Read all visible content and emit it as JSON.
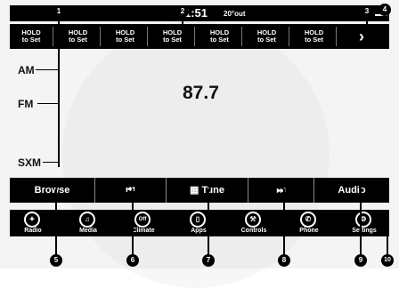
{
  "status": {
    "time": "1:51",
    "temperature": "20°out"
  },
  "presets": [
    "HOLD\nto Set",
    "HOLD\nto Set",
    "HOLD\nto Set",
    "HOLD\nto Set",
    "HOLD\nto Set",
    "HOLD\nto Set",
    "HOLD\nto Set"
  ],
  "preset_l1": "HOLD",
  "preset_l2": "to Set",
  "presets_next": "›",
  "bands": {
    "am": "AM",
    "fm": "FM",
    "sxm": "SXM"
  },
  "frequency": "87.7",
  "controls": {
    "browse": "Browse",
    "seek_back": "⏮",
    "tune": "Tune",
    "seek_fwd": "⏭",
    "audio": "Audio"
  },
  "nav": {
    "radio": "Radio",
    "media": "Media",
    "climate": "Climate",
    "climate_glyph": "Off",
    "apps": "Apps",
    "controls": "Controls",
    "phone": "Phone",
    "settings": "Settings"
  },
  "callouts": [
    "1",
    "2",
    "3",
    "4",
    "5",
    "6",
    "7",
    "8",
    "9",
    "10"
  ]
}
